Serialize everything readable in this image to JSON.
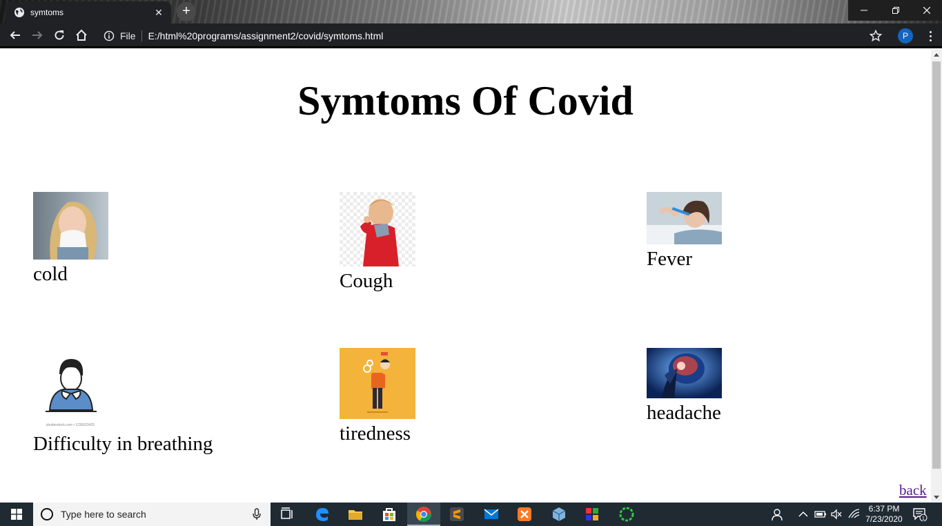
{
  "browser": {
    "tab_title": "symtoms",
    "tab_close": "✕",
    "new_tab": "+",
    "omnibox_scheme": "File",
    "url": "E:/html%20programs/assignment2/covid/symtoms.html",
    "profile_initial": "P"
  },
  "page": {
    "title": "Symtoms Of Covid",
    "symptoms": [
      {
        "label": "cold",
        "icon": "woman-sneezing-photo"
      },
      {
        "label": "Cough",
        "icon": "boy-coughing-photo"
      },
      {
        "label": "Fever",
        "icon": "woman-thermometer-photo"
      },
      {
        "label": "Difficulty in breathing",
        "icon": "man-breathing-illustration"
      },
      {
        "label": "tiredness",
        "icon": "tired-man-illustration"
      },
      {
        "label": "headache",
        "icon": "brain-headache-photo"
      }
    ],
    "breathing_caption": "shutterstock.com • 1235023425",
    "back_link": "back"
  },
  "taskbar": {
    "search_placeholder": "Type here to search",
    "time": "6:37 PM",
    "date": "7/23/2020",
    "notification_count": "1"
  }
}
